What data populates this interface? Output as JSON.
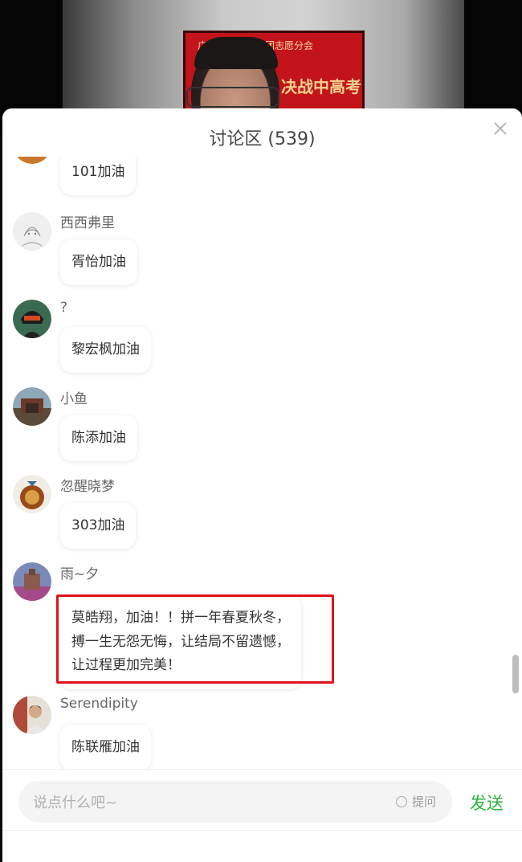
{
  "video": {
    "poster_text_top": "广州市中学线上团志愿分会",
    "poster_text_main": "决战中高考"
  },
  "panel": {
    "title": "讨论区 (539)"
  },
  "messages": [
    {
      "username": "",
      "text": "101加油",
      "avatar": "avatar-orange"
    },
    {
      "username": "西西弗里",
      "text": "胥怡加油",
      "avatar": "avatar-sketch"
    },
    {
      "username": "?",
      "text": "黎宏枫加油",
      "avatar": "avatar-helmet"
    },
    {
      "username": "小鱼",
      "text": "陈添加油",
      "avatar": "avatar-building"
    },
    {
      "username": "忽醒晓梦",
      "text": "303加油",
      "avatar": "avatar-bird"
    },
    {
      "username": "雨~夕",
      "text_lines": [
        "莫皓翔，加油！！拼一年春夏秋冬，",
        "搏一生无怨无悔，让结局不留遗憾，",
        "让过程更加完美！"
      ],
      "avatar": "avatar-city"
    },
    {
      "username": "Serendipity",
      "text": "陈联雁加油",
      "avatar": "avatar-person"
    }
  ],
  "footer": {
    "input_placeholder": "说点什么吧~",
    "question_label": "提问",
    "send_label": "发送"
  },
  "colors": {
    "accent_send": "#27b53a",
    "highlight_border": "#e0121b"
  }
}
